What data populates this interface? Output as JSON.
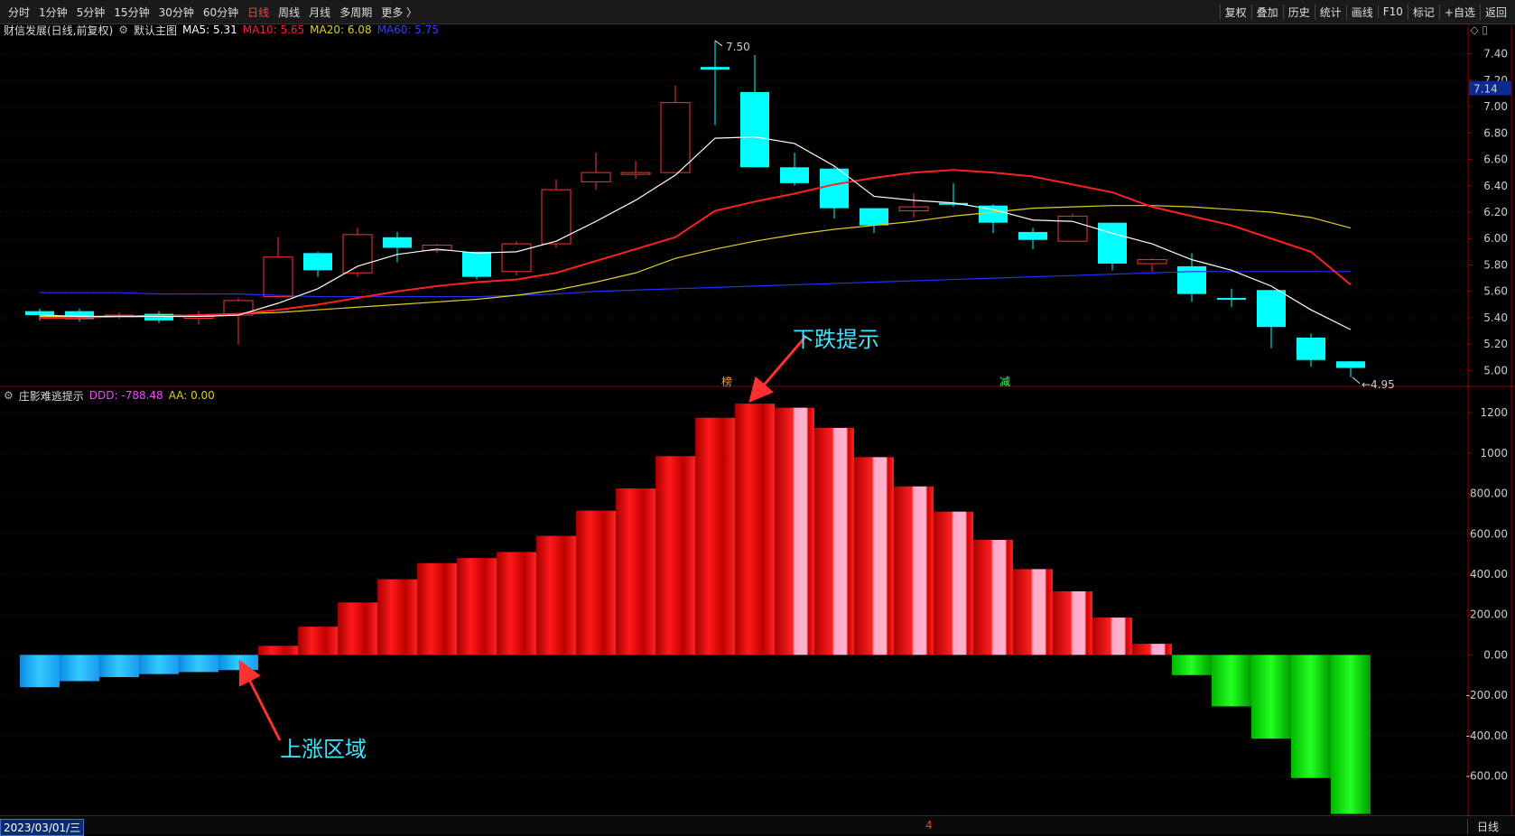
{
  "toolbar": {
    "left": [
      "分时",
      "1分钟",
      "5分钟",
      "15分钟",
      "30分钟",
      "60分钟",
      "日线",
      "周线",
      "月线",
      "多周期",
      "更多 〉"
    ],
    "active": "日线",
    "right": [
      "复权",
      "叠加",
      "历史",
      "统计",
      "画线",
      "F10",
      "标记",
      "+自选",
      "返回"
    ]
  },
  "main_info": {
    "stock": "财信发展(日线,前复权)",
    "main_chart": "默认主图",
    "ma5": "MA5: 5.31",
    "ma10": "MA10: 5.65",
    "ma20": "MA20: 6.08",
    "ma60": "MA60: 5.75"
  },
  "indicator_info": {
    "name": "庄影难逃提示",
    "ddd": "DDD: -788.48",
    "aa": "AA: 0.00"
  },
  "markers": {
    "bang": "榜",
    "jian": "减"
  },
  "annotations": {
    "fall_hint": "下跌提示",
    "rise_zone": "上涨区域"
  },
  "bottom": {
    "date": "2023/03/01/三",
    "month_mark": "4",
    "period": "日线"
  },
  "colors": {
    "up": "#ff3232",
    "down": "#00ffff",
    "ma5": "#ffffff",
    "ma10": "#ff2020",
    "ma20": "#e0d020",
    "ma60": "#2030ff"
  },
  "chart_data": [
    {
      "type": "candlestick",
      "ylim": [
        4.88,
        7.52
      ],
      "y_ticks": [
        "7.40",
        "7.20",
        "7.00",
        "6.80",
        "6.60",
        "6.40",
        "6.20",
        "6.00",
        "5.80",
        "5.60",
        "5.40",
        "5.20",
        "5.00"
      ],
      "price_label": "7.14",
      "high_label": "7.50",
      "low_label": "4.95",
      "candles": [
        {
          "o": 5.45,
          "c": 5.42,
          "h": 5.47,
          "l": 5.38
        },
        {
          "o": 5.45,
          "c": 5.39,
          "h": 5.47,
          "l": 5.37
        },
        {
          "o": 5.41,
          "c": 5.42,
          "h": 5.44,
          "l": 5.39
        },
        {
          "o": 5.43,
          "c": 5.38,
          "h": 5.45,
          "l": 5.36
        },
        {
          "o": 5.41,
          "c": 5.41,
          "h": 5.45,
          "l": 5.35
        },
        {
          "o": 5.42,
          "c": 5.53,
          "h": 5.55,
          "l": 5.2
        },
        {
          "o": 5.56,
          "c": 5.86,
          "h": 6.01,
          "l": 5.55
        },
        {
          "o": 5.89,
          "c": 5.76,
          "h": 5.9,
          "l": 5.71
        },
        {
          "o": 5.74,
          "c": 6.03,
          "h": 6.08,
          "l": 5.71
        },
        {
          "o": 6.01,
          "c": 5.93,
          "h": 6.05,
          "l": 5.82
        },
        {
          "o": 5.91,
          "c": 5.95,
          "h": 5.96,
          "l": 5.89
        },
        {
          "o": 5.9,
          "c": 5.71,
          "h": 5.9,
          "l": 5.69
        },
        {
          "o": 5.75,
          "c": 5.96,
          "h": 5.98,
          "l": 5.72
        },
        {
          "o": 5.96,
          "c": 6.37,
          "h": 6.45,
          "l": 5.93
        },
        {
          "o": 6.43,
          "c": 6.5,
          "h": 6.65,
          "l": 6.37
        },
        {
          "o": 6.5,
          "c": 6.5,
          "h": 6.59,
          "l": 6.45
        },
        {
          "o": 6.5,
          "c": 7.03,
          "h": 7.16,
          "l": 6.5
        },
        {
          "o": 7.3,
          "c": 7.28,
          "h": 7.5,
          "l": 6.86
        },
        {
          "o": 7.11,
          "c": 6.54,
          "h": 7.39,
          "l": 6.54
        },
        {
          "o": 6.54,
          "c": 6.42,
          "h": 6.65,
          "l": 6.4
        },
        {
          "o": 6.53,
          "c": 6.23,
          "h": 6.55,
          "l": 6.15
        },
        {
          "o": 6.23,
          "c": 6.1,
          "h": 6.23,
          "l": 6.04
        },
        {
          "o": 6.21,
          "c": 6.24,
          "h": 6.34,
          "l": 6.16
        },
        {
          "o": 6.27,
          "c": 6.26,
          "h": 6.42,
          "l": 6.24
        },
        {
          "o": 6.25,
          "c": 6.12,
          "h": 6.26,
          "l": 6.04
        },
        {
          "o": 6.05,
          "c": 5.99,
          "h": 6.08,
          "l": 5.92
        },
        {
          "o": 5.98,
          "c": 6.17,
          "h": 6.19,
          "l": 5.98
        },
        {
          "o": 6.12,
          "c": 5.81,
          "h": 6.12,
          "l": 5.76
        },
        {
          "o": 5.81,
          "c": 5.84,
          "h": 5.85,
          "l": 5.75
        },
        {
          "o": 5.79,
          "c": 5.58,
          "h": 5.89,
          "l": 5.52
        },
        {
          "o": 5.55,
          "c": 5.54,
          "h": 5.62,
          "l": 5.48
        },
        {
          "o": 5.61,
          "c": 5.33,
          "h": 5.61,
          "l": 5.17
        },
        {
          "o": 5.25,
          "c": 5.08,
          "h": 5.28,
          "l": 5.03
        },
        {
          "o": 5.07,
          "c": 5.02,
          "h": 5.07,
          "l": 4.95
        }
      ],
      "ma5": [
        5.42,
        5.41,
        5.41,
        5.41,
        5.41,
        5.42,
        5.51,
        5.62,
        5.79,
        5.88,
        5.92,
        5.89,
        5.9,
        5.98,
        6.13,
        6.29,
        6.48,
        6.76,
        6.77,
        6.72,
        6.55,
        6.32,
        6.29,
        6.27,
        6.22,
        6.14,
        6.13,
        6.04,
        5.96,
        5.84,
        5.76,
        5.64,
        5.46,
        5.31
      ],
      "ma10": [
        5.4,
        5.4,
        5.41,
        5.41,
        5.42,
        5.43,
        5.46,
        5.5,
        5.55,
        5.6,
        5.64,
        5.67,
        5.69,
        5.74,
        5.83,
        5.92,
        6.01,
        6.21,
        6.28,
        6.34,
        6.41,
        6.46,
        6.5,
        6.52,
        6.5,
        6.47,
        6.41,
        6.35,
        6.24,
        6.17,
        6.1,
        6.0,
        5.9,
        5.65
      ],
      "ma20": [
        5.41,
        5.41,
        5.41,
        5.42,
        5.42,
        5.43,
        5.44,
        5.46,
        5.48,
        5.5,
        5.52,
        5.54,
        5.57,
        5.61,
        5.67,
        5.74,
        5.85,
        5.92,
        5.98,
        6.03,
        6.07,
        6.1,
        6.13,
        6.17,
        6.2,
        6.23,
        6.24,
        6.25,
        6.25,
        6.24,
        6.22,
        6.2,
        6.16,
        6.08
      ],
      "ma60": [
        5.59,
        5.59,
        5.59,
        5.58,
        5.58,
        5.58,
        5.57,
        5.56,
        5.56,
        5.56,
        5.56,
        5.56,
        5.57,
        5.58,
        5.6,
        5.61,
        5.62,
        5.63,
        5.64,
        5.65,
        5.66,
        5.67,
        5.68,
        5.69,
        5.7,
        5.71,
        5.72,
        5.73,
        5.74,
        5.75,
        5.75,
        5.75,
        5.75,
        5.75
      ]
    },
    {
      "type": "bar",
      "name": "DDD",
      "ylim": [
        -790,
        1250
      ],
      "y_ticks": [
        1200,
        1000,
        800,
        600,
        400,
        200,
        0,
        -200,
        -400,
        -600
      ],
      "y_tick_labels": [
        "1200",
        "1000",
        "800.00",
        "600.00",
        "400.00",
        "200.00",
        "0.00",
        "-200.00",
        "-400.00",
        "-600.00"
      ],
      "values": [
        -160,
        -130,
        -110,
        -95,
        -85,
        -75,
        45,
        140,
        260,
        375,
        455,
        480,
        510,
        590,
        715,
        825,
        985,
        1175,
        1245,
        1225,
        1125,
        980,
        835,
        710,
        570,
        425,
        315,
        185,
        55,
        -100,
        -255,
        -415,
        -610,
        -788
      ],
      "kind": [
        "blue",
        "blue",
        "blue",
        "blue",
        "blue",
        "blue",
        "red",
        "red",
        "red",
        "red",
        "red",
        "red",
        "red",
        "red",
        "red",
        "red",
        "red",
        "red",
        "red",
        "redpink",
        "redpink",
        "redpink",
        "redpink",
        "redpink",
        "redpink",
        "redpink",
        "redpink",
        "redpink",
        "redpink",
        "green",
        "green",
        "green",
        "green",
        "green"
      ]
    }
  ]
}
